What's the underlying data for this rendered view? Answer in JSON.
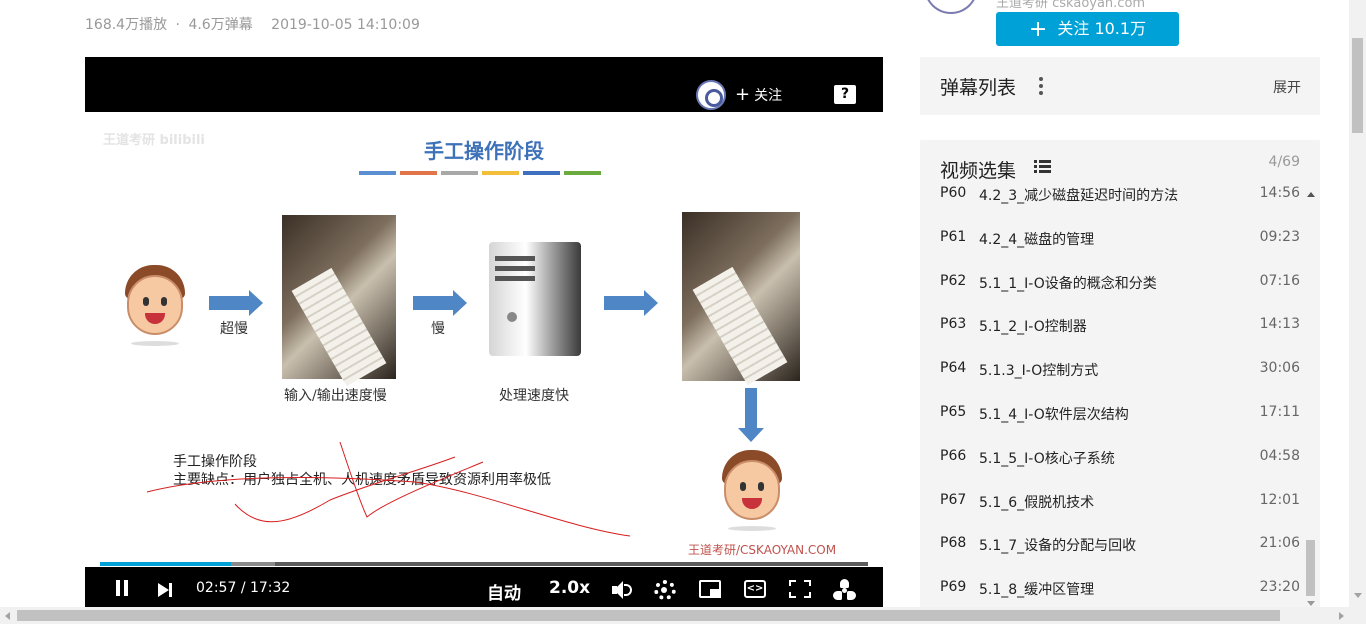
{
  "meta": {
    "plays": "168.4万播放",
    "separator": "·",
    "danmaku_count": "4.6万弹幕",
    "date": "2019-10-05 14:10:09"
  },
  "player": {
    "follow_label": "关注",
    "help_label": "?",
    "slide": {
      "watermark": "王道考研 bilibili",
      "title": "手工操作阶段",
      "bar_colors": [
        "#5b8fd1",
        "#e2744a",
        "#a8a8a8",
        "#f3bf3a",
        "#3f6fbf",
        "#6aaa3f"
      ],
      "label_very_slow": "超慢",
      "label_slow": "慢",
      "caption_io": "输入/输出速度慢",
      "caption_cpu": "处理速度快",
      "note_line1": "手工操作阶段",
      "note_line2": "主要缺点：用户独占全机、人机速度矛盾导致资源利用率极低",
      "brand": "王道考研/CSKAOYAN.COM"
    },
    "progress": {
      "played_fraction": 0.1705,
      "buffered_fraction": 0.228
    },
    "controls": {
      "current_time": "02:57",
      "separator": "/",
      "total_time": "17:32",
      "quality": "自动",
      "speed": "2.0x"
    }
  },
  "sidebar": {
    "up_name": "王道考研 cskaoyan.com",
    "follow_button": "关注 10.1万",
    "danmaku": {
      "title": "弹幕列表",
      "expand": "展开"
    },
    "playlist": {
      "title": "视频选集",
      "count": "4/69",
      "items": [
        {
          "idx": "P60",
          "name": "4.2_3_减少磁盘延迟时间的方法",
          "dur": "14:56"
        },
        {
          "idx": "P61",
          "name": "4.2_4_磁盘的管理",
          "dur": "09:23"
        },
        {
          "idx": "P62",
          "name": "5.1_1_I-O设备的概念和分类",
          "dur": "07:16"
        },
        {
          "idx": "P63",
          "name": "5.1_2_I-O控制器",
          "dur": "14:13"
        },
        {
          "idx": "P64",
          "name": "5.1.3_I-O控制方式",
          "dur": "30:06"
        },
        {
          "idx": "P65",
          "name": "5.1_4_I-O软件层次结构",
          "dur": "17:11"
        },
        {
          "idx": "P66",
          "name": "5.1_5_I-O核心子系统",
          "dur": "04:58"
        },
        {
          "idx": "P67",
          "name": "5.1_6_假脱机技术",
          "dur": "12:01"
        },
        {
          "idx": "P68",
          "name": "5.1_7_设备的分配与回收",
          "dur": "21:06"
        },
        {
          "idx": "P69",
          "name": "5.1_8_缓冲区管理",
          "dur": "23:20"
        }
      ]
    }
  },
  "colors": {
    "accent": "#00a1d6",
    "panel_bg": "#f4f4f4",
    "slide_title": "#3e72b8",
    "arrow": "#4f86c6",
    "ink": "#d81e1e"
  }
}
